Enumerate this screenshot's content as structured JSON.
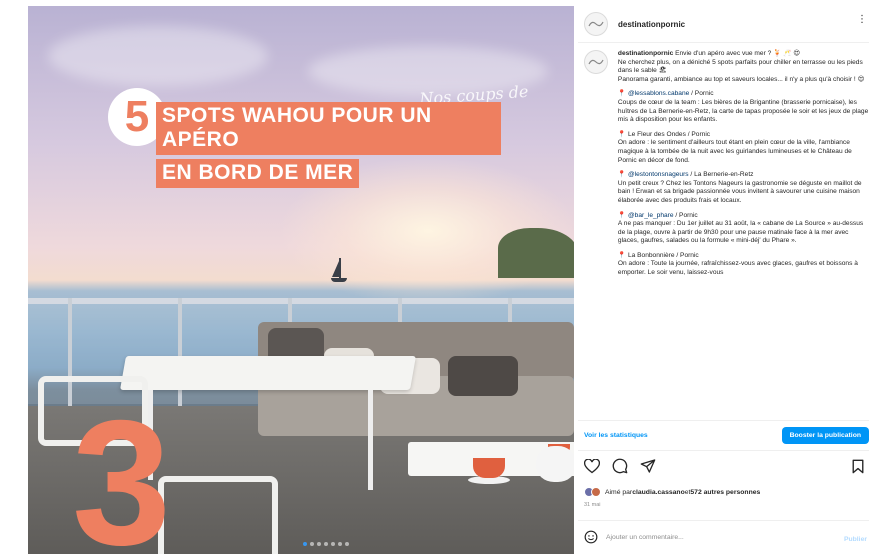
{
  "post_image": {
    "title_number": "5",
    "title_line1": "SPOTS WAHOU POUR UN APÉRO",
    "title_line2": "EN BORD DE MER",
    "script_text": "Nos coups de cœur",
    "big_number": "3",
    "carousel_total": 7,
    "carousel_active": 0,
    "accent_color": "#ee7f60"
  },
  "panel": {
    "header": {
      "username": "destinationpornic",
      "avatar_icon": "brand-avatar",
      "more_icon": "more-horizontal-icon"
    },
    "caption": {
      "username": "destinationpornic",
      "intro": "Envie d'un apéro avec vue mer ? 🍹 🥂 😍",
      "intro2": "Ne cherchez plus, on a déniché 5 spots parfaits pour chiller en terrasse ou les pieds dans le sable 🏖",
      "intro3": "Panorama garanti, ambiance au top et saveurs locales... il n'y a plus qu'à choisir ! 😍",
      "spots": [
        {
          "pin": "📍",
          "name": "@lessablons.cabane",
          "place": " / Pornic",
          "desc": "Coups de cœur de la team : Les bières de la Brigantine (brasserie pornicaise), les huîtres de La Bernerie-en-Retz, la carte de tapas proposée le soir et les jeux de plage mis à disposition pour les enfants."
        },
        {
          "pin": "📍",
          "name": "Le Fleur des Ondes",
          "place": " / Pornic",
          "desc": "On adore : le sentiment d'ailleurs tout étant en plein cœur de la ville, l'ambiance magique à la tombée de la nuit avec les guirlandes lumineuses et le Château de Pornic en décor de fond."
        },
        {
          "pin": "📍",
          "name": "@lestontonsnageurs",
          "place": " / La Bernerie-en-Retz",
          "desc": "Un petit creux ? Chez les Tontons Nageurs la gastronomie se déguste en maillot de bain ! Erwan et sa brigade passionnée vous invitent à savourer une cuisine maison élaborée avec des produits frais et locaux."
        },
        {
          "pin": "📍",
          "name": "@bar_le_phare",
          "place": " / Pornic",
          "desc": "A ne pas manquer : Du 1er juillet au 31 août, la « cabane de La Source » au-dessus de la plage, ouvre à partir de 9h30 pour une pause matinale face à la mer avec glaces, gaufres, salades ou la formule « mini-déj' du Phare »."
        },
        {
          "pin": "📍",
          "name": "La Bonbonnière",
          "place": " / Pornic",
          "desc": "On adore : Toute la journée, rafraîchissez-vous avec glaces, gaufres et boissons à emporter. Le soir venu, laissez-vous"
        }
      ]
    },
    "actions": {
      "stats_label": "Voir les statistiques",
      "boost_label": "Booster la publication"
    },
    "icons": [
      "heart-icon",
      "comment-icon",
      "share-icon"
    ],
    "likes": {
      "prefix": "Aimé par ",
      "user": "claudia.cassano",
      "middle": " et ",
      "others": "572 autres personnes"
    },
    "date": "31 mai",
    "comment": {
      "placeholder": "Ajouter un commentaire...",
      "post_label": "Publier"
    }
  }
}
